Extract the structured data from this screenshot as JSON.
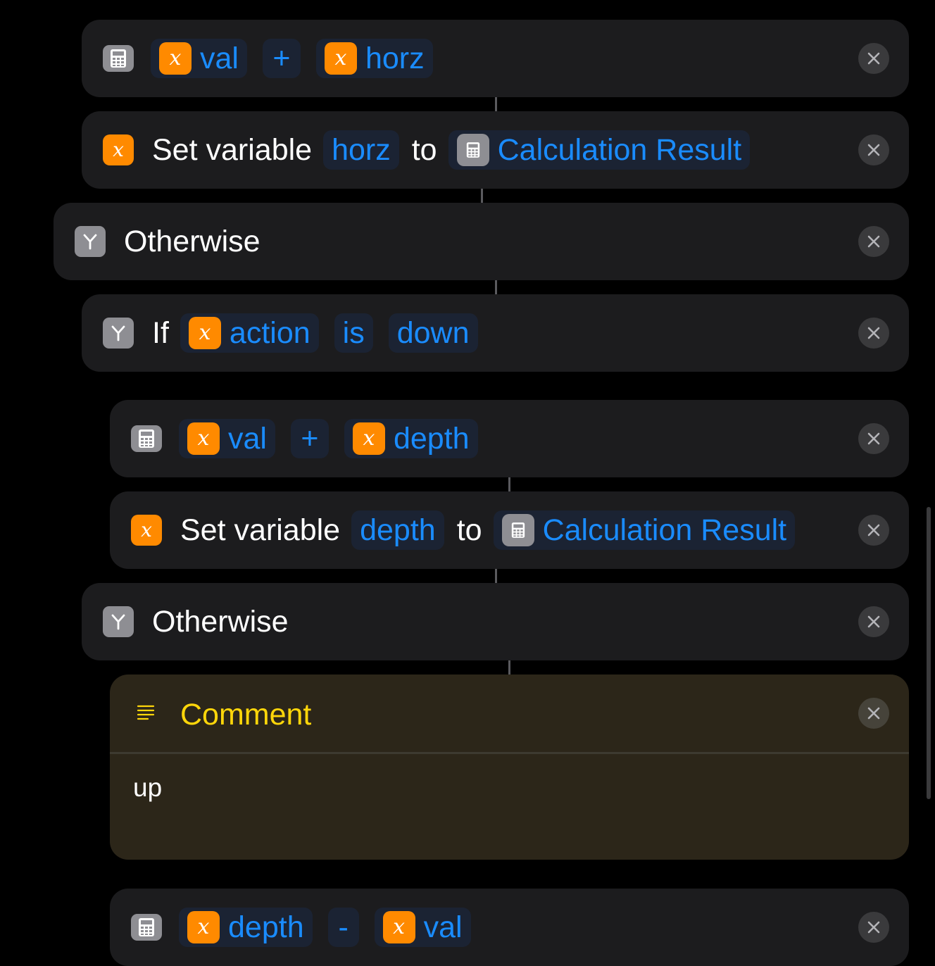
{
  "colors": {
    "background": "#000000",
    "card": "#1c1c1e",
    "token_text": "#1a8cff",
    "token_bg": "#1b2333",
    "variable_icon": "#ff8a00",
    "comment_bg": "#2c2619",
    "comment_title": "#ffd60a"
  },
  "icons": {
    "calculate": "calculator-icon",
    "variable": "variable-x-icon",
    "branch": "branch-icon",
    "comment": "comment-lines-icon",
    "remove": "close-icon"
  },
  "actions": {
    "calc1": {
      "operand_a": "val",
      "operator": "+",
      "operand_b": "horz"
    },
    "set1": {
      "label": "Set variable",
      "variable": "horz",
      "to": "to",
      "value": "Calculation Result"
    },
    "otherwise1": {
      "label": "Otherwise"
    },
    "if1": {
      "label": "If",
      "variable": "action",
      "condition": "is",
      "value": "down"
    },
    "calc2": {
      "operand_a": "val",
      "operator": "+",
      "operand_b": "depth"
    },
    "set2": {
      "label": "Set variable",
      "variable": "depth",
      "to": "to",
      "value": "Calculation Result"
    },
    "otherwise2": {
      "label": "Otherwise"
    },
    "comment": {
      "title": "Comment",
      "body": "up"
    },
    "calc3": {
      "operand_a": "depth",
      "operator": "-",
      "operand_b": "val"
    }
  }
}
